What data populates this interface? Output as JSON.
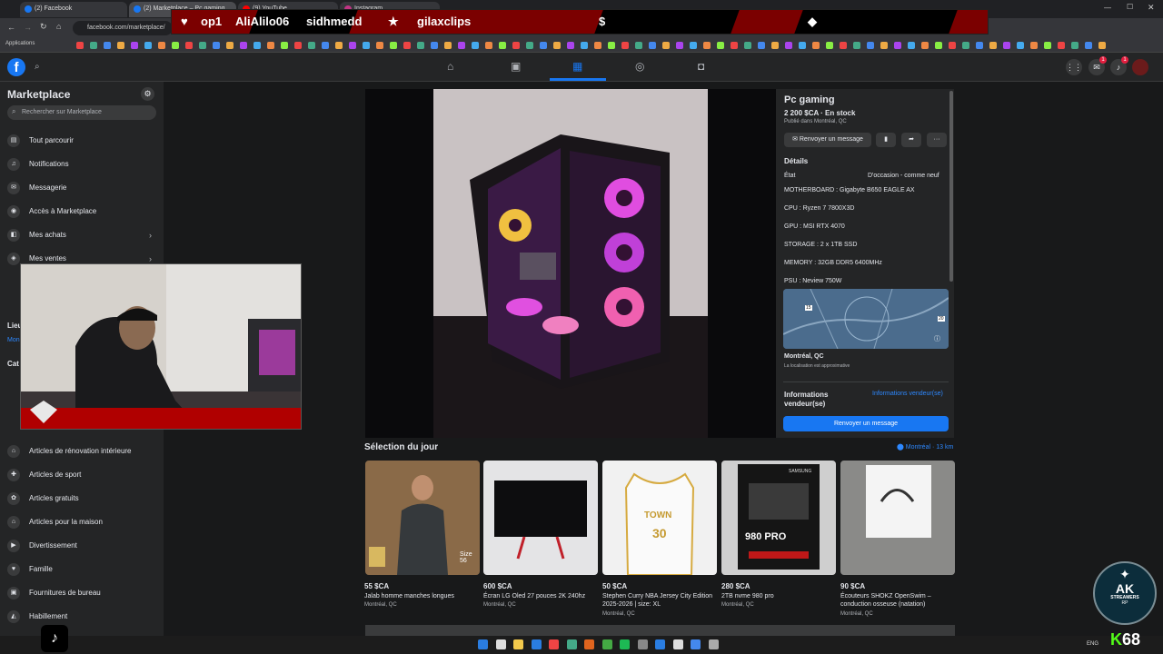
{
  "browser": {
    "tabs": [
      {
        "label": "(2) Facebook"
      },
      {
        "label": "(2) Marketplace – Pc gaming"
      },
      {
        "label": "(9) YouTube"
      },
      {
        "label": "Instagram"
      }
    ],
    "address": "facebook.com/marketplace/",
    "bookmarks_label": "Applications"
  },
  "stream_overlay": {
    "names": [
      "op1",
      "AliAlilo06",
      "sidhmedd",
      "gilaxclips"
    ]
  },
  "sidebar": {
    "title": "Marketplace",
    "search_placeholder": "Rechercher sur Marketplace",
    "items": [
      {
        "label": "Tout parcourir",
        "icon": "storefront-icon"
      },
      {
        "label": "Notifications",
        "icon": "bell-icon"
      },
      {
        "label": "Messagerie",
        "icon": "inbox-icon"
      },
      {
        "label": "Accès à Marketplace",
        "icon": "access-icon"
      },
      {
        "label": "Mes achats",
        "icon": "bag-icon"
      },
      {
        "label": "Mes ventes",
        "icon": "tag-icon"
      },
      {
        "label": "Articles de rénovation intérieure",
        "icon": "tools-icon"
      },
      {
        "label": "Articles de sport",
        "icon": "sport-icon"
      },
      {
        "label": "Articles gratuits",
        "icon": "gift-icon"
      },
      {
        "label": "Articles pour la maison",
        "icon": "home-icon"
      },
      {
        "label": "Divertissement",
        "icon": "film-icon"
      },
      {
        "label": "Famille",
        "icon": "heart-icon"
      },
      {
        "label": "Fournitures de bureau",
        "icon": "briefcase-icon"
      },
      {
        "label": "Habillement",
        "icon": "shirt-icon"
      }
    ],
    "partial_labels": {
      "lieu": "Lieu",
      "mon": "Mon",
      "cat": "Cat"
    }
  },
  "listing": {
    "title": "Pc gaming",
    "price_line": "2 200 $CA · En stock",
    "published": "Publié dans Montréal, QC",
    "message_button": "Renvoyer un message",
    "details_heading": "Détails",
    "condition_label": "État",
    "condition_value": "D'occasion - comme neuf",
    "specs": [
      "MOTHERBOARD : Gigabyte B650 EAGLE AX",
      "CPU : Ryzen 7 7800X3D",
      "GPU : MSI RTX 4070",
      "STORAGE : 2 x 1TB SSD",
      "MEMORY : 32GB DDR5 6400MHz",
      "PSU : Neview 750W"
    ],
    "map_road_1": "15",
    "map_road_2": "20",
    "location": "Montréal, QC",
    "location_note": "La localisation est approximative",
    "seller_heading": "Informations vendeur(se)",
    "seller_link": "Informations vendeur(se)",
    "cta": "Renvoyer un message"
  },
  "selection": {
    "title": "Sélection du jour",
    "location": "Montréal · 13 km",
    "cards": [
      {
        "price": "55 $CA",
        "title": "Jalab homme manches longues",
        "location": "Montréal, QC",
        "badge": "Size 56"
      },
      {
        "price": "600 $CA",
        "title": "Écran LG Oled 27 pouces 2K 240hz",
        "location": "Montréal, QC"
      },
      {
        "price": "50 $CA",
        "title": "Stephen Curry NBA Jersey City Edition 2025-2026 | size: XL",
        "location": "Montréal, QC",
        "jersey_text": "TOWN",
        "jersey_number": "30"
      },
      {
        "price": "280 $CA",
        "title": "2TB nvme 980 pro",
        "location": "Montréal, QC",
        "box_text": "980 PRO",
        "brand": "SAMSUNG"
      },
      {
        "price": "90 $CA",
        "title": "Écouteurs SHOKZ OpenSwim – conduction osseuse (natation)",
        "location": "Montréal, QC"
      }
    ]
  },
  "stream": {
    "ak_line1": "AK",
    "ak_line2": "STREAMERS",
    "ak_line3": "RP",
    "counter": "68",
    "tray_lang": "ENG"
  },
  "colors": {
    "fb_blue": "#1877f2",
    "bg": "#18191a",
    "panel": "#242526",
    "overlay_red": "#7b0000"
  }
}
